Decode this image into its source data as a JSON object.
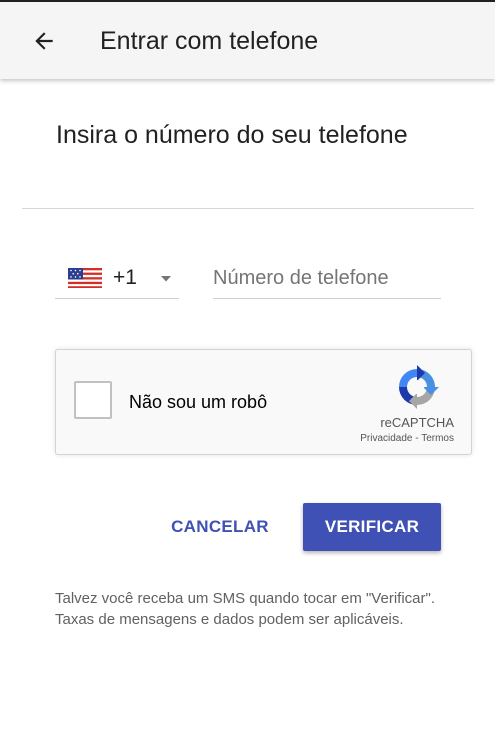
{
  "app_bar": {
    "back_icon": "arrow-back-icon",
    "title": "Entrar com telefone"
  },
  "heading": "Insira o número do seu telefone",
  "phone": {
    "country_flag_icon": "us-flag-icon",
    "country_code": "+1",
    "dropdown_icon": "caret-down-icon",
    "placeholder": "Número de telefone",
    "value": ""
  },
  "recaptcha": {
    "checkbox_label": "Não sou um robô",
    "checked": false,
    "logo_icon": "recaptcha-logo-icon",
    "brand": "reCAPTCHA",
    "privacy_link": "Privacidade",
    "separator": " - ",
    "terms_link": "Termos"
  },
  "actions": {
    "cancel_label": "CANCELAR",
    "verify_label": "VERIFICAR"
  },
  "notice": "Talvez você receba um SMS quando tocar em \"Verificar\". Taxas de mensagens e dados podem ser aplicáveis.",
  "colors": {
    "primary": "#3f51b5",
    "app_bar_bg": "#f5f5f5",
    "text": "#212121",
    "muted_text": "#616161"
  }
}
